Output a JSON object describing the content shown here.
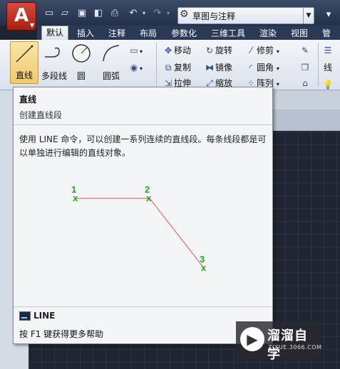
{
  "quick_access": {
    "workspace": "草图与注释"
  },
  "tabs": [
    "默认",
    "插入",
    "注释",
    "布局",
    "参数化",
    "三维工具",
    "渲染",
    "视图",
    "管理"
  ],
  "ribbon": {
    "draw": {
      "line": "直线",
      "polyline": "多段线",
      "circle": "圆",
      "arc": "圆弧"
    },
    "modify": {
      "move": "移动",
      "rotate": "旋转",
      "trim": "修剪",
      "copy": "复制",
      "mirror": "镜像",
      "fillet": "圆角",
      "stretch": "拉伸",
      "scale": "缩放",
      "array": "阵列"
    },
    "layer_label": "线"
  },
  "tooltip": {
    "title": "直线",
    "subtitle": "创建直线段",
    "description": "使用 LINE 命令，可以创建一系列连续的直线段。每条线段都是可以单独进行编辑的直线对象。",
    "diagram_points": [
      "1",
      "2",
      "3"
    ],
    "diagram_marker": "x",
    "command": "LINE",
    "help": "按 F1 键获得更多帮助"
  },
  "watermark": {
    "name": "溜溜自学",
    "url": "ZIXUE.3066.COM"
  },
  "colors": {
    "accent_red": "#c0392b",
    "diagram_point": "#22aa22",
    "diagram_line": "#e05050"
  }
}
